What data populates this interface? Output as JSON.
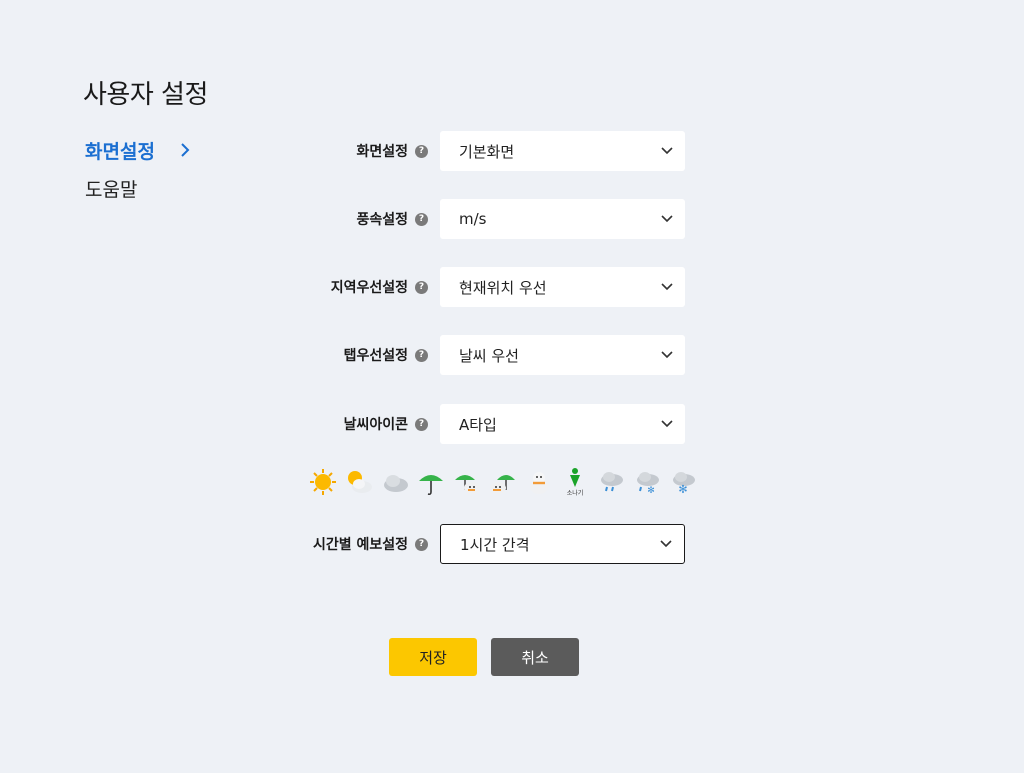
{
  "page": {
    "title": "사용자 설정"
  },
  "sidebar": {
    "items": [
      {
        "label": "화면설정",
        "active": true
      },
      {
        "label": "도움말",
        "active": false
      }
    ]
  },
  "form": {
    "help_glyph": "?",
    "rows": [
      {
        "label": "화면설정",
        "value": "기본화면"
      },
      {
        "label": "풍속설정",
        "value": "m/s"
      },
      {
        "label": "지역우선설정",
        "value": "현재위치 우선"
      },
      {
        "label": "탭우선설정",
        "value": "날씨 우선"
      },
      {
        "label": "날씨아이콘",
        "value": "A타입"
      },
      {
        "label": "시간별 예보설정",
        "value": "1시간 간격"
      }
    ]
  },
  "weather_icons": {
    "items": [
      "sun-icon",
      "sun-cloud-icon",
      "cloud-icon",
      "umbrella-icon",
      "umbrella-cloud-icon",
      "umbrella-rain-icon",
      "snowman-icon",
      "shower-icon",
      "rain-cloud-icon",
      "sleet-cloud-icon",
      "snow-cloud-icon"
    ],
    "shower_label": "소나기"
  },
  "buttons": {
    "save": "저장",
    "cancel": "취소"
  },
  "colors": {
    "accent": "#1b6fd1",
    "save": "#fcc700",
    "cancel": "#5b5b5b",
    "background": "#eef1f6"
  }
}
